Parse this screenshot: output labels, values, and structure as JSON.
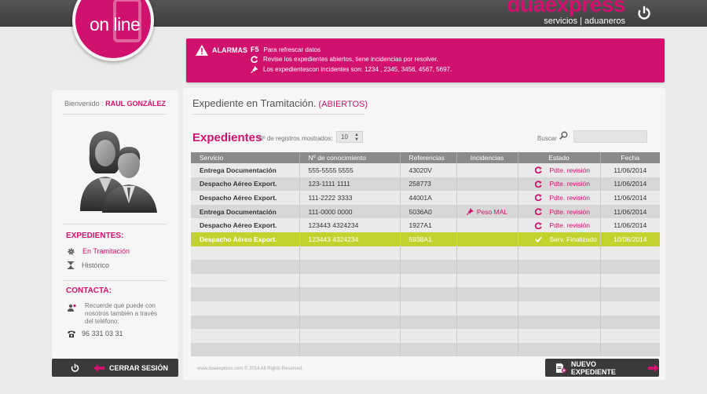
{
  "header": {
    "logo_text": "on line",
    "brand_name": "duaexpress",
    "brand_tagline": "servicios | aduaneros"
  },
  "alarm": {
    "title": "ALARMAS",
    "lines": [
      {
        "key": "F5",
        "text": "Para refrescar datos"
      },
      {
        "key": "refresh-icon",
        "text": "Revise los expedientes abiertos, tiene incidencias por resolver."
      },
      {
        "key": "pin-icon",
        "text": "Los expedientescon incidentes son: 1234 , 2345, 3456, 4567, 5697."
      }
    ]
  },
  "sidebar": {
    "welcome_label": "Bienvenido :",
    "user_name": "RAUL GONZÁLEZ",
    "expedientes_title": "EXPEDIENTES:",
    "items": [
      {
        "label": "En Tramitación",
        "icon": "gear-icon"
      },
      {
        "label": "Histórico",
        "icon": "hourglass-icon"
      }
    ],
    "contacta_title": "CONTACTA:",
    "contact_text": "Recuerde que puede con nosotros también a través del teléfono:",
    "phone": "96 331 03 31",
    "logout_label": "CERRAR SESIÓN"
  },
  "main": {
    "title": "Expediente en Tramitación.",
    "title_sub": "(ABIERTOS)",
    "exp_title": "Expedientes",
    "count_label": "Nº de registros mostrados:",
    "count_value": "10",
    "search_label": "Buscar",
    "columns": [
      "Servicio",
      "Nº de conocimiento",
      "Referencias",
      "Incidencias",
      "Estado",
      "Fecha"
    ],
    "rows": [
      {
        "servicio": "Entrega Documentación",
        "conocimiento": "555-5555 5555",
        "referencia": "43020V",
        "incidencia": "",
        "estado": "Pdte. revisión",
        "fecha": "11/06/2014"
      },
      {
        "servicio": "Despacho Aéreo Export.",
        "conocimiento": "123-1111 1111",
        "referencia": "258773",
        "incidencia": "",
        "estado": "Pdte. revisión",
        "fecha": "11/06/2014"
      },
      {
        "servicio": "Despacho Aéreo Export.",
        "conocimiento": "111-2222 3333",
        "referencia": "44001A",
        "incidencia": "",
        "estado": "Pdte. revisión",
        "fecha": "11/06/2014"
      },
      {
        "servicio": "Entrega Documentación",
        "conocimiento": "111-0000 0000",
        "referencia": "5036A0",
        "incidencia": "Peso MAL",
        "estado": "Pdte. revisión",
        "fecha": "11/06/2014"
      },
      {
        "servicio": "Despacho Aéreo Export.",
        "conocimiento": "123443 4324234",
        "referencia": "1927A1",
        "incidencia": "",
        "estado": "Pdte. revisión",
        "fecha": "11/06/2014"
      },
      {
        "servicio": "Despacho Aéreo Export.",
        "conocimiento": "123443 4324234",
        "referencia": "5938A1",
        "incidencia": "",
        "estado": "Serv. Finalizado",
        "fecha": "10/06/2014",
        "highlight": true
      }
    ],
    "empty_rows": 8,
    "footer": "www.duaexpress.com © 2014 All Rights Reserved.",
    "new_button_label": "NUEVO EXPEDIENTE"
  },
  "colors": {
    "accent": "#d0116e",
    "highlight": "#c4d230",
    "dark": "#3a3a3a"
  }
}
